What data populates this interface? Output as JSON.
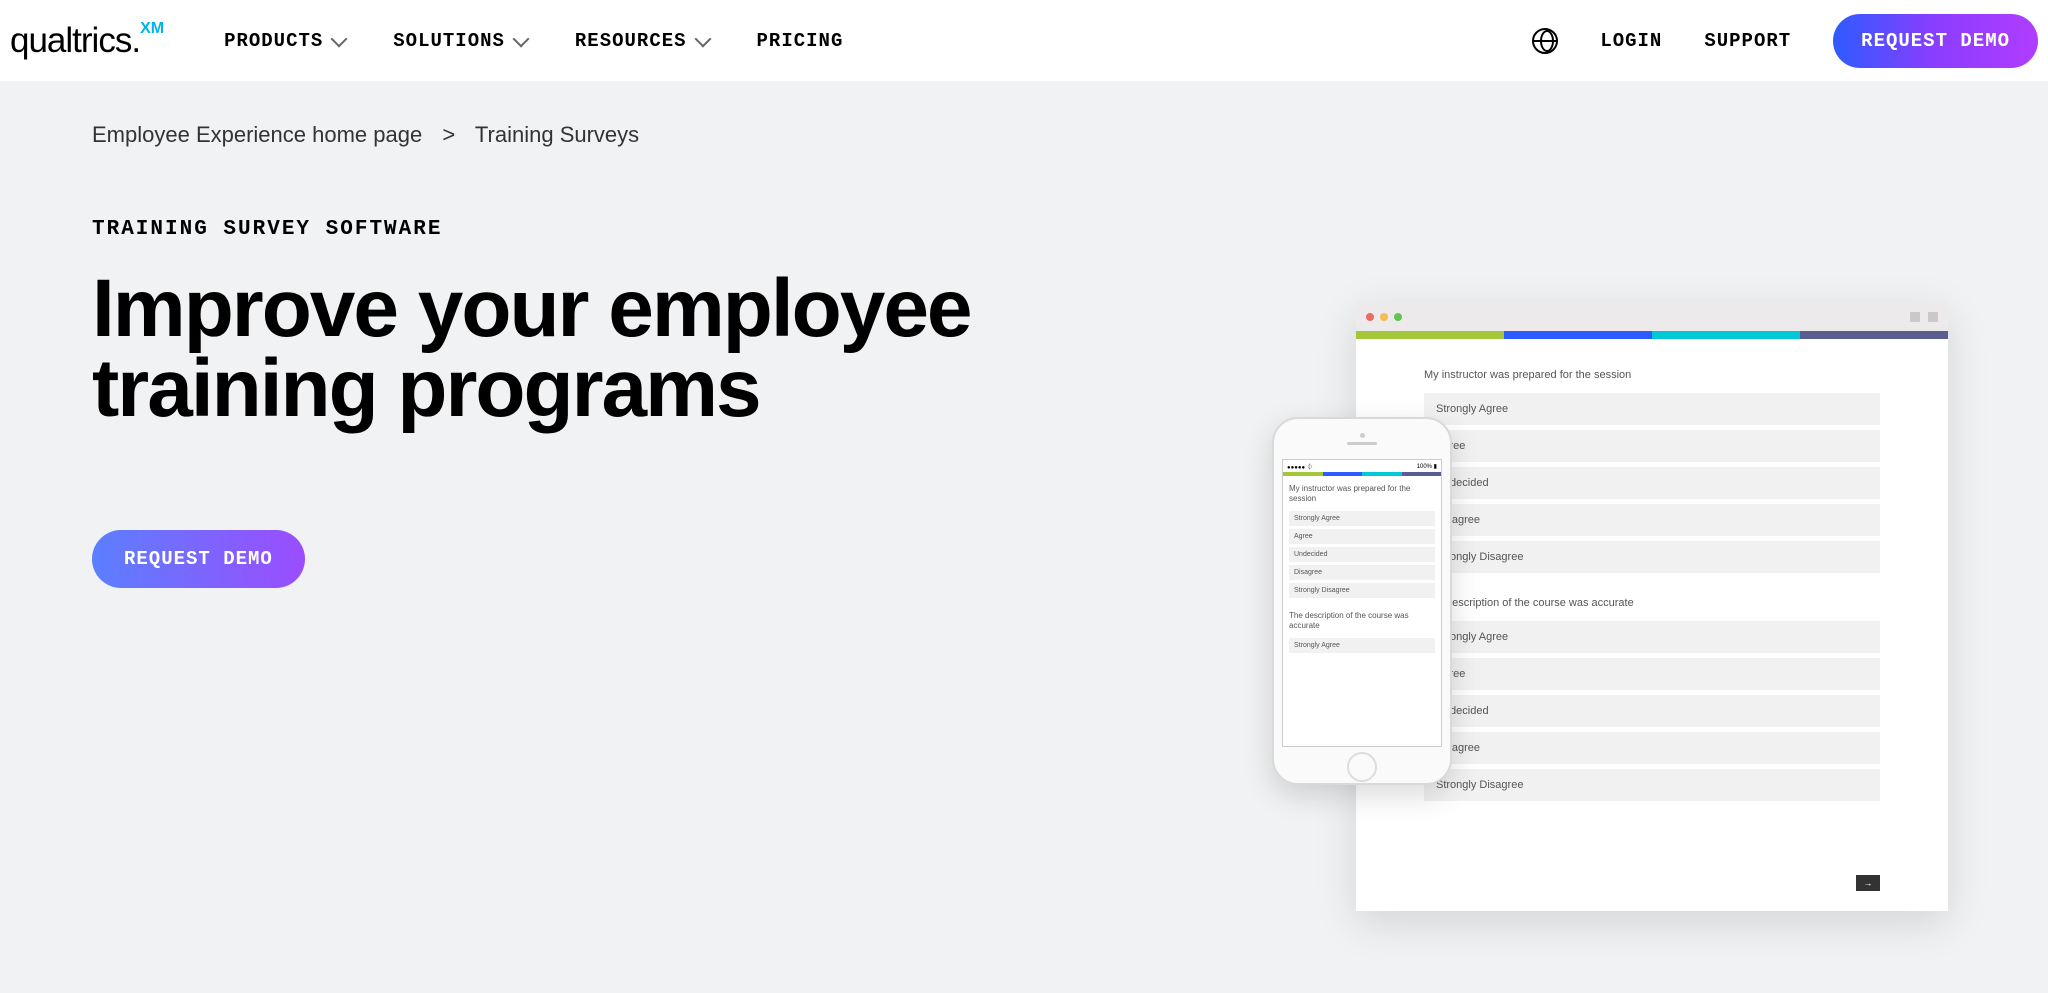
{
  "logo": {
    "text": "qualtrics.",
    "xm": "XM"
  },
  "nav": [
    {
      "label": "PRODUCTS",
      "hasDropdown": true
    },
    {
      "label": "SOLUTIONS",
      "hasDropdown": true
    },
    {
      "label": "RESOURCES",
      "hasDropdown": true
    },
    {
      "label": "PRICING",
      "hasDropdown": false
    }
  ],
  "headerRight": {
    "login": "LOGIN",
    "support": "SUPPORT",
    "demo": "REQUEST DEMO"
  },
  "breadcrumb": {
    "home": "Employee Experience home page",
    "current": "Training Surveys"
  },
  "eyebrow": "TRAINING SURVEY SOFTWARE",
  "headline": "Improve your employee training programs",
  "bodyDemo": "REQUEST DEMO",
  "survey": {
    "q1": {
      "title": "My instructor was prepared for the session",
      "opts": [
        "Strongly Agree",
        "Agree",
        "Undecided",
        "Disagree",
        "Strongly Disagree"
      ]
    },
    "q2": {
      "title": "The description of the course was accurate",
      "opts": [
        "Strongly Agree",
        "Agree",
        "Undecided",
        "Disagree",
        "Strongly Disagree"
      ]
    }
  },
  "phone": {
    "statusLeft": "●●●●● ⏀",
    "statusRight": "100% ▮",
    "q1": {
      "title": "My instructor was prepared for the session",
      "opts": [
        "Strongly Agree",
        "Agree",
        "Undecided",
        "Disagree",
        "Strongly Disagree"
      ]
    },
    "q2": {
      "title": "The description of the course was accurate",
      "opts": [
        "Strongly Agree"
      ]
    }
  },
  "pagerArrow": "→"
}
